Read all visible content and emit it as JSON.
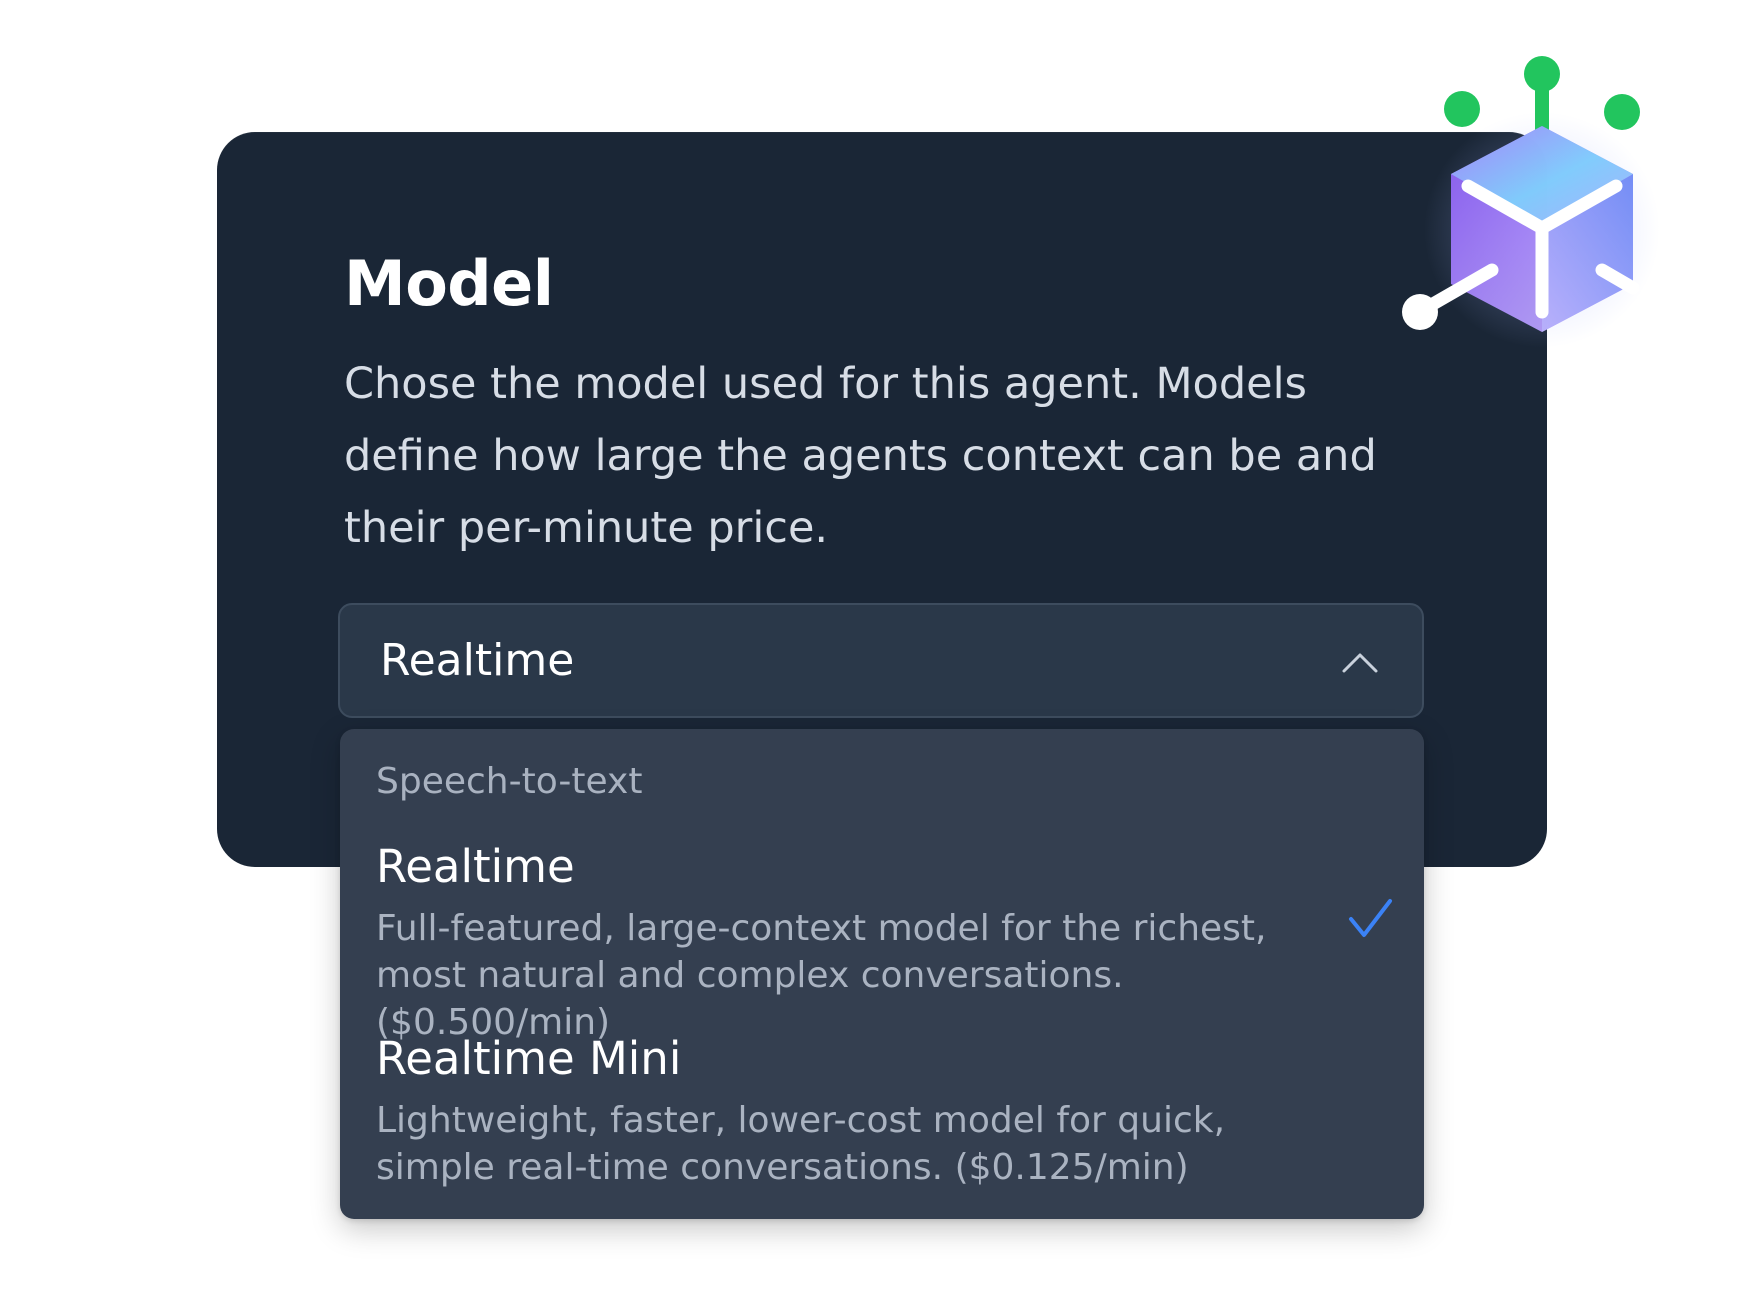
{
  "model_section": {
    "title": "Model",
    "description": "Chose the model used for this agent. Models define how large the agents context can be and their per-minute price."
  },
  "model_select": {
    "selected_value": "Realtime",
    "expanded": true,
    "icon": "chevron-up-icon"
  },
  "dropdown": {
    "group_label": "Speech-to-text",
    "options": [
      {
        "title": "Realtime",
        "description": "Full-featured, large-context model for the richest, most natural and complex conversations. ($0.500/min)",
        "selected": true
      },
      {
        "title": "Realtime Mini",
        "description": "Lightweight, faster, lower-cost model for quick, simple real-time conversations. ($0.125/min)",
        "selected": false
      }
    ],
    "selected_icon": "checkmark-icon"
  },
  "decoration": {
    "icon": "ai-agent-cube-icon"
  },
  "colors": {
    "card_background": "#1a2636",
    "select_background": "#2a3849",
    "dropdown_background": "#343f50",
    "check_accent": "#3b82f6",
    "node_green": "#22c55e"
  }
}
